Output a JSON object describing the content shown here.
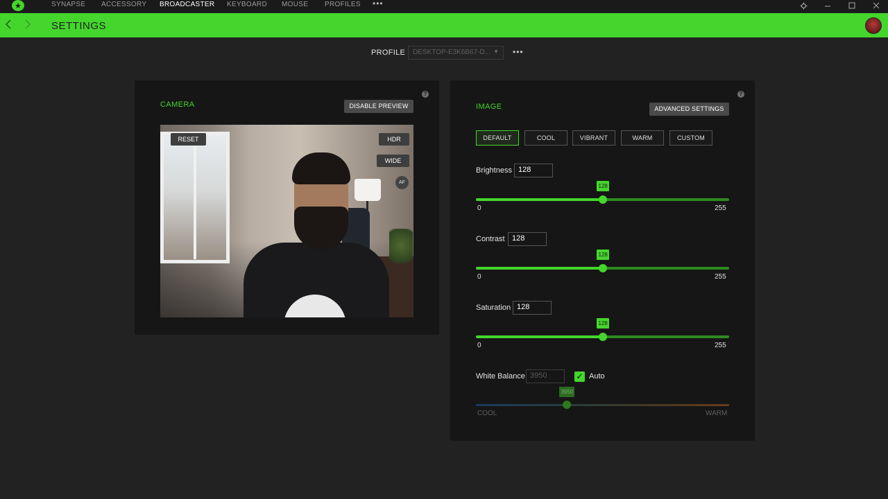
{
  "nav": {
    "items": [
      {
        "label": "SYNAPSE",
        "active": false
      },
      {
        "label": "ACCESSORY",
        "active": false
      },
      {
        "label": "BROADCASTER",
        "active": true
      },
      {
        "label": "KEYBOARD",
        "active": false
      },
      {
        "label": "MOUSE",
        "active": false
      },
      {
        "label": "PROFILES",
        "active": false
      }
    ],
    "more": "•••",
    "window_icons": [
      "settings-gear-icon",
      "minimize-icon",
      "maximize-icon",
      "close-icon"
    ]
  },
  "header": {
    "title": "SETTINGS",
    "back_icon": "chevron-left-icon",
    "forward_icon": "chevron-right-icon",
    "accent_color": "#44d62c"
  },
  "profile": {
    "label": "PROFILE",
    "value": "DESKTOP-E3K6B67-D...",
    "more": "•••"
  },
  "camera": {
    "title": "CAMERA",
    "disable_preview": "DISABLE PREVIEW",
    "reset": "RESET",
    "hdr": "HDR",
    "wide": "WIDE",
    "af": "AF"
  },
  "image": {
    "title": "IMAGE",
    "advanced_settings": "ADVANCED SETTINGS",
    "presets": [
      "DEFAULT",
      "COOL",
      "VIBRANT",
      "WARM",
      "CUSTOM"
    ],
    "active_preset": "DEFAULT",
    "sliders": [
      {
        "label": "Brightness",
        "value": 128,
        "min": 0,
        "max": 255
      },
      {
        "label": "Contrast",
        "value": 128,
        "min": 0,
        "max": 255
      },
      {
        "label": "Saturation",
        "value": 128,
        "min": 0,
        "max": 255
      }
    ],
    "white_balance": {
      "label": "White Balance",
      "value": 3950,
      "auto_label": "Auto",
      "auto_checked": true,
      "min_label": "COOL",
      "max_label": "WARM",
      "position_fraction": 0.36
    }
  }
}
